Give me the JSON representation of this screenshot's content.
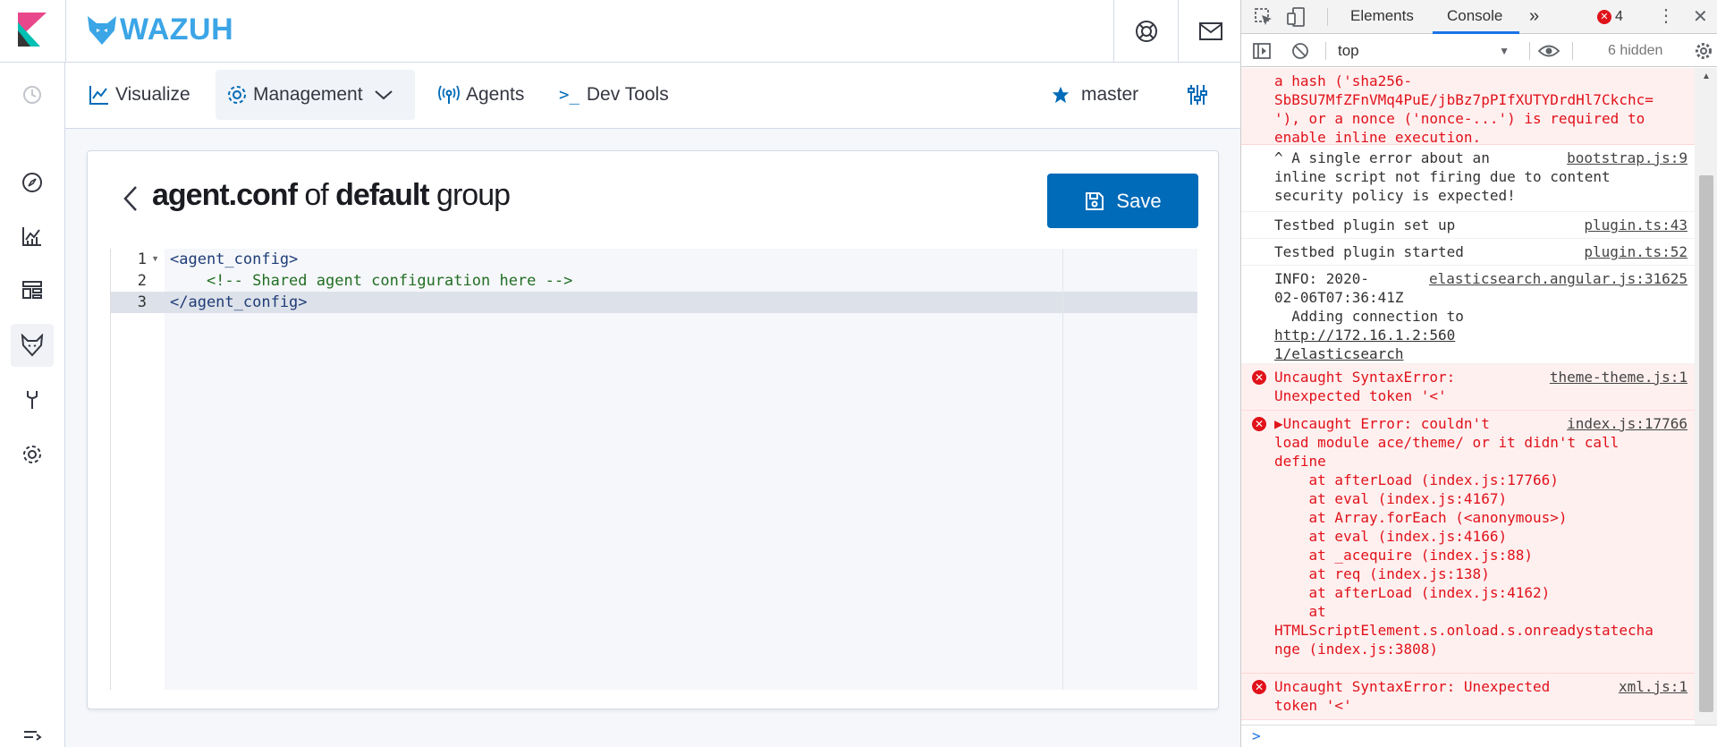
{
  "app": {
    "name": "WAZUH"
  },
  "menu": {
    "visualize": "Visualize",
    "management": "Management",
    "agents": "Agents",
    "devtools": "Dev Tools",
    "cluster": "master"
  },
  "page": {
    "title_file": "agent.conf",
    "title_of": " of ",
    "title_group_name": "default",
    "title_group": " group",
    "save": "Save"
  },
  "editor": {
    "line_numbers": [
      "1",
      "2",
      "3"
    ],
    "lines": [
      "<agent_config>",
      "    <!-- Shared agent configuration here -->",
      "</agent_config>"
    ]
  },
  "devtools": {
    "tabs": {
      "elements": "Elements",
      "console": "Console",
      "more": "»"
    },
    "error_count": "4",
    "context": "top",
    "hidden": "6 hidden",
    "messages": [
      {
        "type": "error",
        "text": "a hash ('sha256-\nSbBSU7MfZFnVMq4PuE/jbBz7pPIfXUTYDrdHl7Ckchc=\n'), or a nonce ('nonce-...') is required to\nenable inline execution.",
        "source": ""
      },
      {
        "type": "info",
        "text": "^ A single error about an\ninline script not firing due to content\nsecurity policy is expected!",
        "source": "bootstrap.js:9"
      },
      {
        "type": "info",
        "text": "Testbed plugin set up",
        "source": "plugin.ts:43"
      },
      {
        "type": "info",
        "text": "Testbed plugin started",
        "source": "plugin.ts:52"
      },
      {
        "type": "info",
        "text": "INFO: 2020-\n02-06T07:36:41Z\n  Adding connection to ",
        "link": "http://172.16.1.2:560\n1/elasticsearch",
        "source": "elasticsearch.angular.js:31625"
      },
      {
        "type": "error",
        "text": "Uncaught SyntaxError:\nUnexpected token '<'",
        "source": "theme-theme.js:1"
      },
      {
        "type": "error",
        "text": "▶Uncaught Error: couldn't\nload module ace/theme/ or it didn't call\ndefine\n    at afterLoad (index.js:17766)\n    at eval (index.js:4167)\n    at Array.forEach (<anonymous>)\n    at eval (index.js:4166)\n    at _acequire (index.js:88)\n    at req (index.js:138)\n    at afterLoad (index.js:4162)\n    at\nHTMLScriptElement.s.onload.s.onreadystatecha\nnge (index.js:3808)",
        "source": "index.js:17766"
      },
      {
        "type": "error",
        "text": "Uncaught SyntaxError: Unexpected\ntoken '<'",
        "source": "xml.js:1"
      }
    ]
  },
  "colors": {
    "brand": "#3ba5e6",
    "primary": "#006bb8",
    "error": "#e0121a"
  }
}
